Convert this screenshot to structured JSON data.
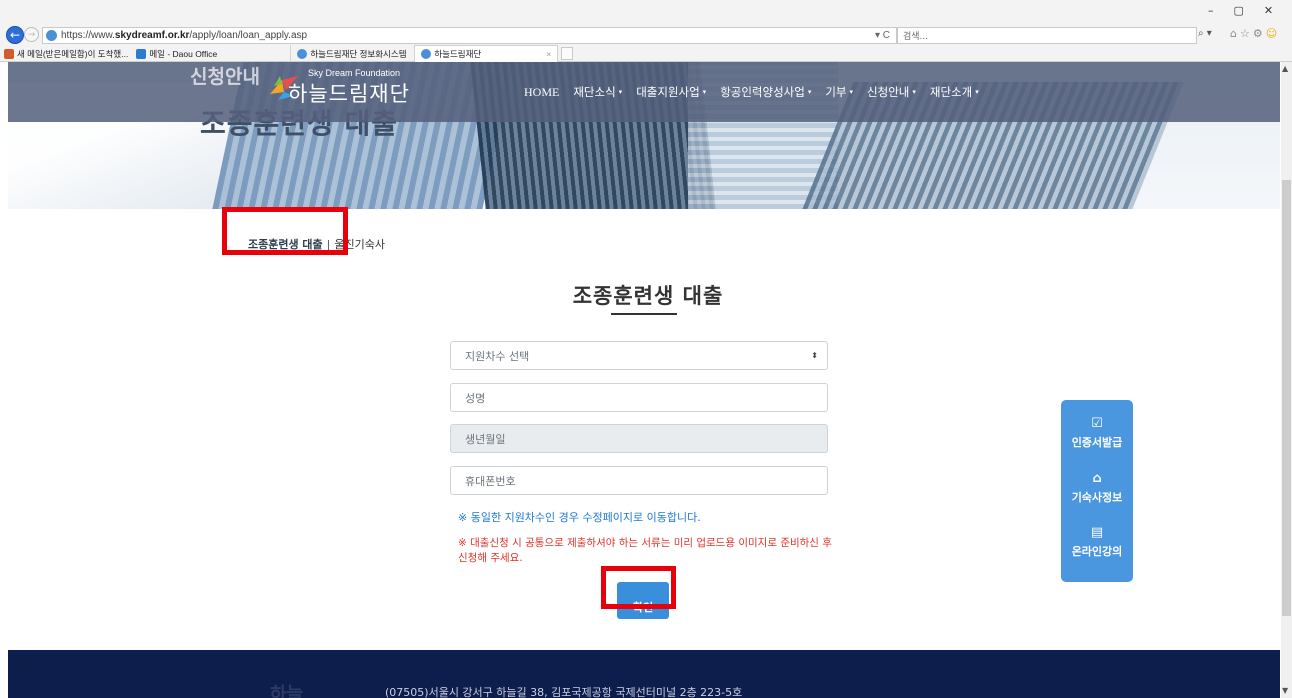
{
  "browser": {
    "url_prefix": "https://www.",
    "url_host": "skydreamf.or.kr",
    "url_path": "/apply/loan/loan_apply.asp",
    "url_tail": "▾ C",
    "search_placeholder": "검색...",
    "search_icon": "magnifier-icon",
    "window_controls": [
      "–",
      "▢",
      "✕"
    ],
    "favorites": [
      {
        "label": "새 메일(받은메일함)이 도착했...",
        "color": "#d35a2a"
      },
      {
        "label": "메일 - Daou Office",
        "color": "#2f7ad1"
      }
    ],
    "tabs": [
      {
        "label": "하늘드림재단 정보화시스템",
        "active": false
      },
      {
        "label": "하늘드림재단",
        "active": true
      }
    ],
    "close_glyph": "×"
  },
  "site": {
    "logo_en": "Sky Dream Foundation",
    "logo_ko": "하늘드림재단",
    "hero_title_top": "신청안내",
    "hero_title": "조종훈련생 대출",
    "menu": [
      {
        "label": "HOME",
        "caret": ""
      },
      {
        "label": "재단소식",
        "caret": "▾"
      },
      {
        "label": "대출지원사업",
        "caret": "▾"
      },
      {
        "label": "항공인력양성사업",
        "caret": "▾"
      },
      {
        "label": "기부",
        "caret": "▾"
      },
      {
        "label": "신청안내",
        "caret": "▾"
      },
      {
        "label": "재단소개",
        "caret": "▾"
      }
    ]
  },
  "breadcrumb": {
    "current": "조종훈련생 대출",
    "separator": "|",
    "other": "울진기숙사"
  },
  "form": {
    "title": "조종훈련생 대출",
    "round_select": "지원차수 선택",
    "select_caret": "⬍",
    "name_placeholder": "성명",
    "birth_placeholder": "생년월일",
    "phone_placeholder": "휴대폰번호",
    "note_blue": "※ 동일한 지원차수인 경우 수정페이지로 이동합니다.",
    "note_red": "※ 대출신청 시 공통으로 제출하셔야 하는 서류는 미리 업로드용 이미지로 준비하신 후 신청해 주세요.",
    "confirm_label": "확인"
  },
  "quick_menu": [
    {
      "icon": "certificate-icon",
      "glyph": "☑",
      "label": "인증서발급"
    },
    {
      "icon": "house-icon",
      "glyph": "⌂",
      "label": "기숙사정보"
    },
    {
      "icon": "laptop-icon",
      "glyph": "▤",
      "label": "온라인강의"
    }
  ],
  "footer": {
    "logo": "하늘",
    "address": "(07505)서울시 강서구 하늘길 38, 김포국제공항 국제선터미널 2층 223-5호"
  },
  "colors": {
    "highlight_box": "#e8000b",
    "primary_blue": "#3a8fdd",
    "note_blue": "#1e78d4",
    "note_red": "#e0342a",
    "footer_bg": "#0d1d4c"
  }
}
